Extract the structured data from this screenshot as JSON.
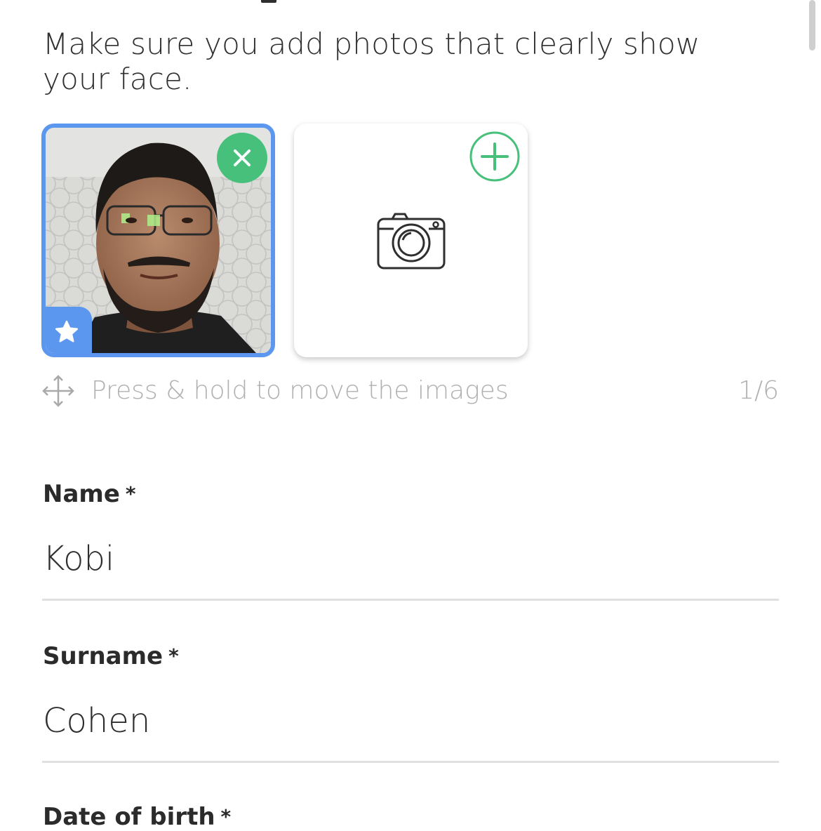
{
  "intro_text": "Make sure you add photos that clearly show your face.",
  "photos": {
    "hint": "Press & hold to move the images",
    "counter": "1/6",
    "accent_color": "#5b97ef",
    "action_color": "#47c07b",
    "icons": {
      "remove": "close-icon",
      "primary": "star-icon",
      "add": "plus-circle-icon",
      "placeholder": "camera-icon",
      "move": "move-arrows-icon"
    }
  },
  "form": {
    "name": {
      "label": "Name",
      "required_mark": "*",
      "value": "Kobi"
    },
    "surname": {
      "label": "Surname",
      "required_mark": "*",
      "value": "Cohen"
    },
    "dob": {
      "label": "Date of birth",
      "required_mark": "*"
    }
  }
}
